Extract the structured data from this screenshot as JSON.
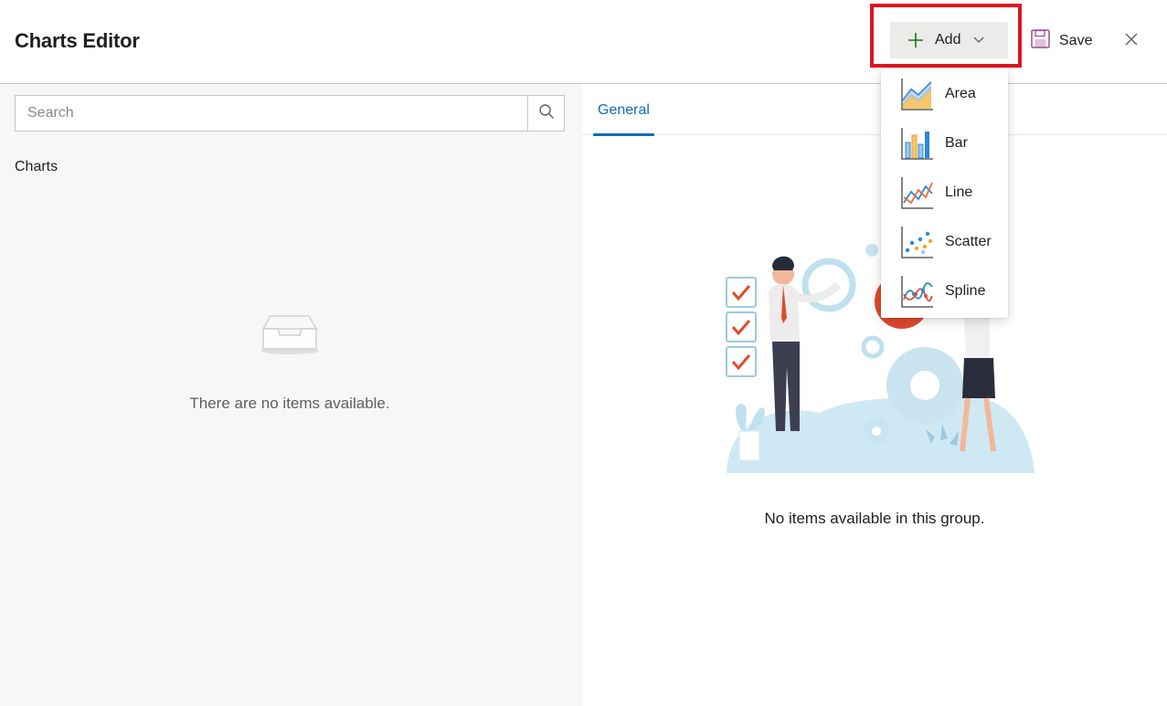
{
  "header": {
    "title": "Charts Editor",
    "add_label": "Add",
    "save_label": "Save",
    "close_icon": "close-icon"
  },
  "left_pane": {
    "search_placeholder": "Search",
    "section_label": "Charts",
    "empty_text": "There are no items available."
  },
  "right_pane": {
    "tabs": [
      {
        "label": "General",
        "selected": true
      }
    ],
    "empty_text": "No items available in this group."
  },
  "add_menu": {
    "items": [
      {
        "label": "Area",
        "icon": "area-chart-icon"
      },
      {
        "label": "Bar",
        "icon": "bar-chart-icon"
      },
      {
        "label": "Line",
        "icon": "line-chart-icon"
      },
      {
        "label": "Scatter",
        "icon": "scatter-chart-icon"
      },
      {
        "label": "Spline",
        "icon": "spline-chart-icon"
      }
    ]
  },
  "colors": {
    "accent": "#0f6cbd",
    "highlight": "#e0141e",
    "add_plus": "#107c10",
    "save_icon": "#9b4f96"
  }
}
